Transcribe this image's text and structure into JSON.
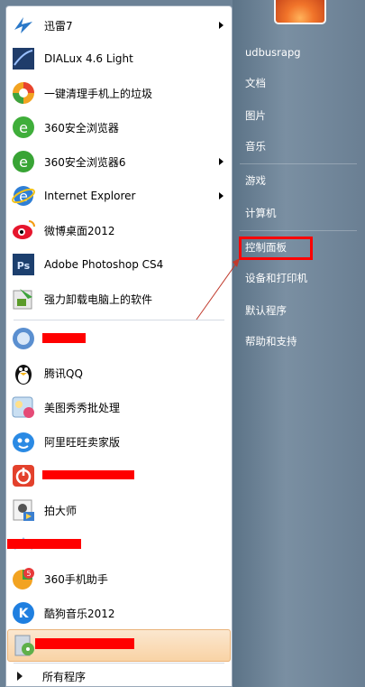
{
  "programs": [
    {
      "label": "迅雷7",
      "icon": "xunlei-bird-icon",
      "has_arrow": true
    },
    {
      "label": "DIALux 4.6 Light",
      "icon": "dialux-icon",
      "has_arrow": false
    },
    {
      "label": "一键清理手机上的垃圾",
      "icon": "cleaner-ball-icon",
      "has_arrow": false
    },
    {
      "label": "360安全浏览器",
      "icon": "360-browser-icon",
      "has_arrow": false
    },
    {
      "label": "360安全浏览器6",
      "icon": "360-browser6-icon",
      "has_arrow": true
    },
    {
      "label": "Internet Explorer",
      "icon": "internet-explorer-icon",
      "has_arrow": true
    },
    {
      "label": "微博桌面2012",
      "icon": "weibo-icon",
      "has_arrow": false
    },
    {
      "label": "Adobe Photoshop CS4",
      "icon": "photoshop-icon",
      "has_arrow": false
    },
    {
      "label": "强力卸载电脑上的软件",
      "icon": "uninstaller-icon",
      "has_arrow": false
    },
    {
      "label": "",
      "icon": "circle-app-icon",
      "has_arrow": false
    },
    {
      "label": "腾讯QQ",
      "icon": "qq-penguin-icon",
      "has_arrow": false
    },
    {
      "label": "美图秀秀批处理",
      "icon": "meitu-batch-icon",
      "has_arrow": false
    },
    {
      "label": "阿里旺旺卖家版",
      "icon": "aliwangwang-icon",
      "has_arrow": false
    },
    {
      "label": "",
      "icon": "red-power-icon",
      "has_arrow": false
    },
    {
      "label": "拍大师",
      "icon": "paidashi-icon",
      "has_arrow": false
    },
    {
      "label": "",
      "icon": "wings-app-icon",
      "has_arrow": false
    },
    {
      "label": "360手机助手",
      "icon": "360-phone-assistant-icon",
      "has_arrow": false
    },
    {
      "label": "酷狗音乐2012",
      "icon": "kugou-icon",
      "has_arrow": false
    },
    {
      "label": "",
      "icon": "installer-disc-icon",
      "has_arrow": false
    }
  ],
  "all_programs": "所有程序",
  "right_items": [
    {
      "label": "udbusrapg"
    },
    {
      "label": "文档"
    },
    {
      "label": "图片"
    },
    {
      "label": "音乐"
    },
    {
      "label": "游戏"
    },
    {
      "label": "计算机"
    },
    {
      "label": "控制面板"
    },
    {
      "label": "设备和打印机"
    },
    {
      "label": "默认程序"
    },
    {
      "label": "帮助和支持"
    }
  ],
  "colors": {
    "highlight_border": "#ff0000",
    "redaction": "#ff0000",
    "right_panel": "#6c8296"
  }
}
